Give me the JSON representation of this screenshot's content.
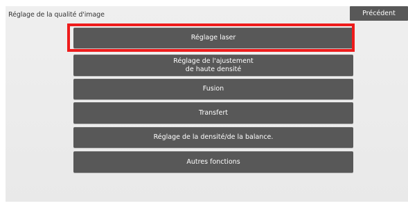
{
  "screen": {
    "title": "Réglage de la qualité d'image",
    "back_label": "Précédent"
  },
  "menu": {
    "items": [
      {
        "label": "Réglage laser"
      },
      {
        "label_line1": "Réglage de l'ajustement",
        "label_line2": "de haute densité"
      },
      {
        "label": "Fusion"
      },
      {
        "label": "Transfert"
      },
      {
        "label": "Réglage de la densité/de la balance."
      },
      {
        "label": "Autres fonctions"
      }
    ]
  },
  "colors": {
    "panel": "#ececec",
    "button": "#585858",
    "highlight": "#ee1c1c"
  }
}
